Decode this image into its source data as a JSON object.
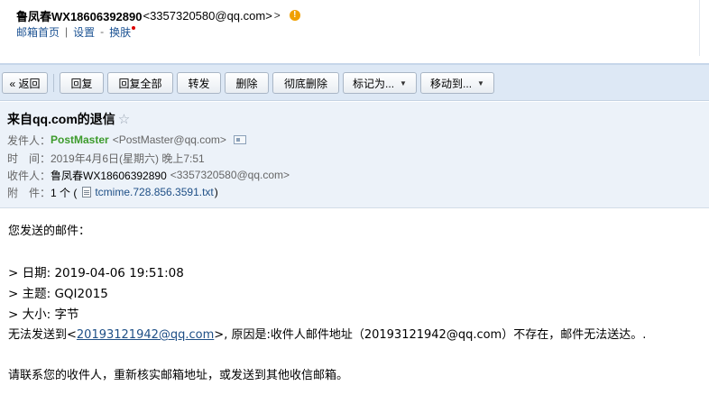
{
  "account": {
    "name": "鲁凤春WX18606392890",
    "email": "<3357320580@qq.com>",
    "arrow": ">",
    "warn": "!"
  },
  "nav": {
    "home": "邮箱首页",
    "sep1": "|",
    "settings": "设置",
    "sep2": "-",
    "skin": "换肤"
  },
  "toolbar": {
    "back": "« 返回",
    "reply": "回复",
    "reply_all": "回复全部",
    "forward": "转发",
    "delete": "删除",
    "delete_permanent": "彻底删除",
    "mark_as": "标记为...",
    "move_to": "移动到...",
    "caret": "▼"
  },
  "mail": {
    "subject": "来自qq.com的退信",
    "star": "☆",
    "from_label": "发件人：",
    "from_name": "PostMaster",
    "from_email": "<PostMaster@qq.com>",
    "time_label": "时　间：",
    "time_value": "2019年4月6日(星期六) 晚上7:51",
    "to_label": "收件人：",
    "to_name": "鲁凤春WX18606392890",
    "to_email": "<3357320580@qq.com>",
    "attach_label": "附　件：",
    "attach_count": "1 个 (",
    "attach_name": "tcmime.728.856.3591.txt",
    "attach_close": ")"
  },
  "body": {
    "intro": "您发送的邮件：",
    "date_line": "> 日期: 2019-04-06 19:51:08",
    "subject_line": "> 主题: GQI2015",
    "size_line": "> 大小: 字节",
    "fail_prefix": "无法发送到<",
    "fail_addr": "20193121942@qq.com",
    "fail_suffix": ">, 原因是:收件人邮件地址（20193121942@qq.com）不存在，邮件无法送达。.",
    "advice": "请联系您的收件人，重新核实邮箱地址，或发送到其他收信邮箱。"
  }
}
